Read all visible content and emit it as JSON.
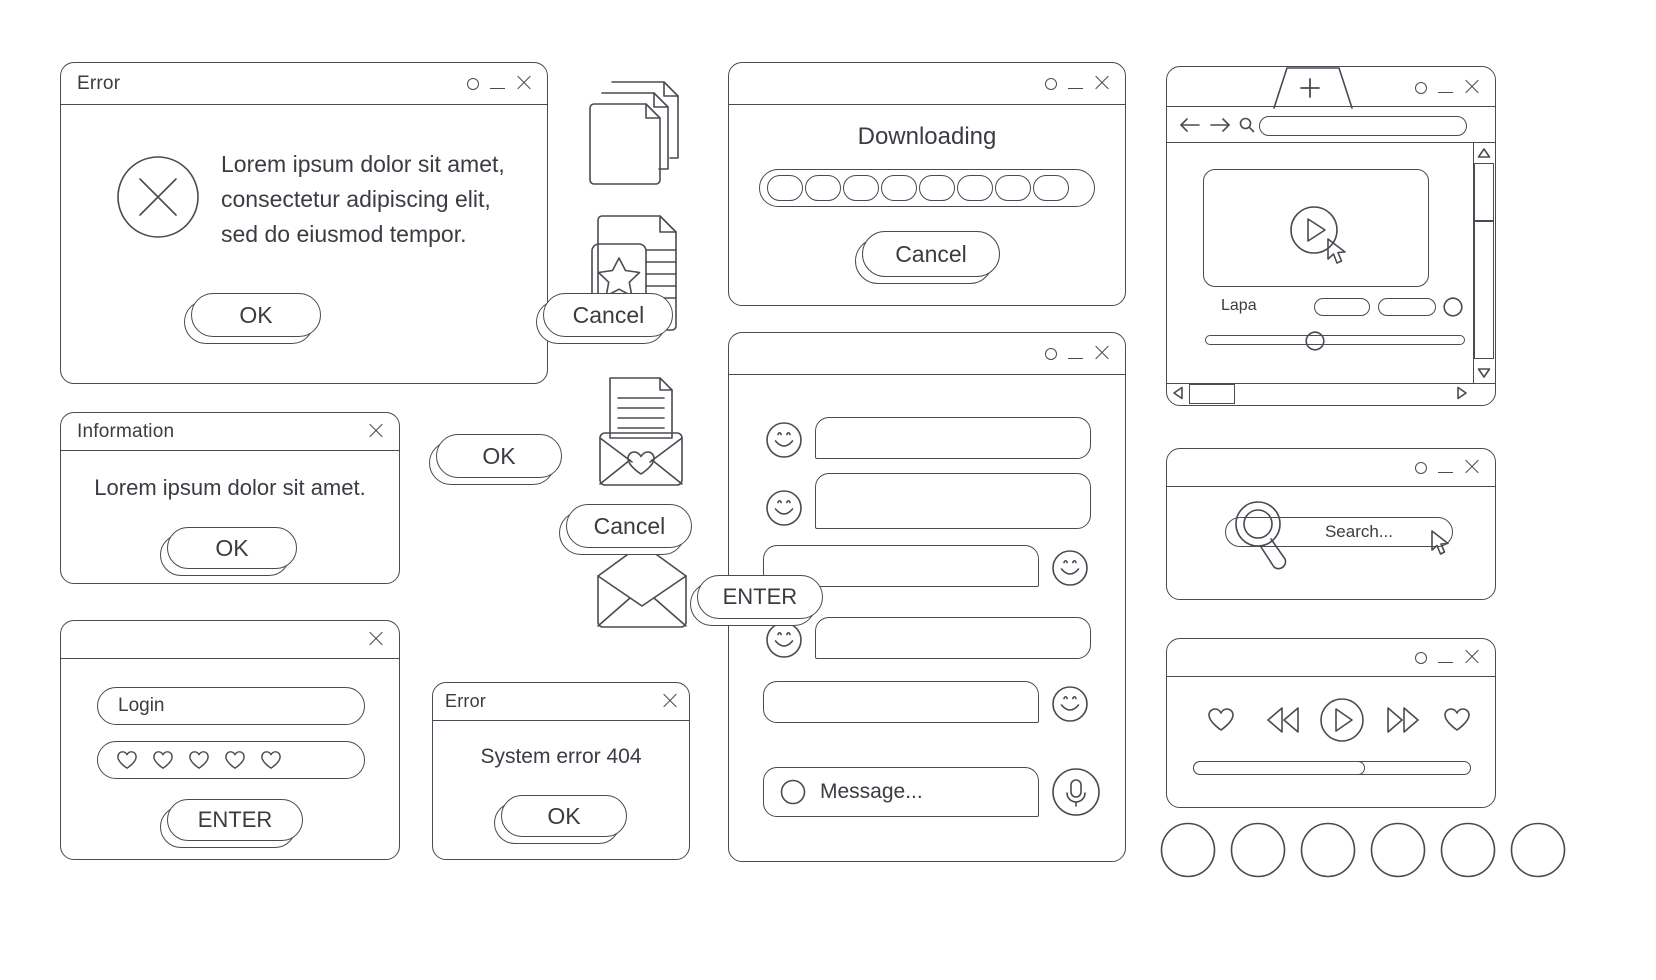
{
  "palette": {
    "stroke": "#4a4a52",
    "text": "#3b3b42",
    "background": "#ffffff"
  },
  "error_dialog": {
    "title": "Error",
    "icon": "error-circle-x-icon",
    "message_lines": [
      "Lorem ipsum dolor sit amet,",
      "consectetur adipiscing elit,",
      "sed do eiusmod tempor."
    ],
    "ok_label": "OK",
    "cancel_label": "Cancel",
    "controls": [
      "minimize-circle-icon",
      "minimize-icon",
      "close-icon"
    ]
  },
  "information_dialog": {
    "title": "Information",
    "message": "Lorem ipsum dolor sit amet.",
    "ok_label": "OK",
    "controls": [
      "close-icon"
    ]
  },
  "login_dialog": {
    "title": "",
    "username_value": "Login",
    "password_dots": 5,
    "password_icon": "heart-icon",
    "enter_label": "ENTER",
    "controls": [
      "close-icon"
    ]
  },
  "error404_dialog": {
    "title": "Error",
    "message": "System error 404",
    "ok_label": "OK",
    "controls": [
      "close-icon"
    ]
  },
  "standalone_buttons": [
    {
      "label": "OK"
    },
    {
      "label": "Cancel"
    },
    {
      "label": "ENTER"
    }
  ],
  "file_icons": [
    {
      "name": "documents-stack-icon"
    },
    {
      "name": "favorite-document-star-icon"
    },
    {
      "name": "mail-letter-heart-icon"
    },
    {
      "name": "open-envelope-icon"
    }
  ],
  "downloading_dialog": {
    "title": "",
    "heading": "Downloading",
    "progress_segments": 8,
    "cancel_label": "Cancel",
    "controls": [
      "minimize-circle-icon",
      "minimize-icon",
      "close-icon"
    ]
  },
  "chat_window": {
    "title": "",
    "controls": [
      "minimize-circle-icon",
      "minimize-icon",
      "close-icon"
    ],
    "messages": [
      {
        "side": "left",
        "avatar": "smiley-icon",
        "text": ""
      },
      {
        "side": "left",
        "avatar": "smiley-icon",
        "text": ""
      },
      {
        "side": "right",
        "avatar": "smiley-icon",
        "text": ""
      },
      {
        "side": "left",
        "avatar": "smiley-icon",
        "text": ""
      },
      {
        "side": "right",
        "avatar": "smiley-icon",
        "text": ""
      }
    ],
    "composer": {
      "attach_icon": "circle-icon",
      "placeholder": "Message...",
      "mic_icon": "microphone-icon"
    }
  },
  "browser_window": {
    "title": "",
    "controls": [
      "minimize-circle-icon",
      "minimize-icon",
      "close-icon"
    ],
    "new_tab_icon": "plus-icon",
    "nav": {
      "back_icon": "arrow-left-icon",
      "forward_icon": "arrow-right-icon",
      "search_icon": "search-icon",
      "address_value": ""
    },
    "video": {
      "play_icon": "play-circle-icon",
      "cursor_icon": "cursor-arrow-icon",
      "label": "Lapa",
      "pill_buttons": 2,
      "round_button_icon": "circle-icon",
      "slider_position_percent": 42
    },
    "scrollbars": {
      "vertical": {
        "up_icon": "triangle-up-icon",
        "down_icon": "triangle-down-icon"
      },
      "horizontal": {
        "left_icon": "triangle-left-icon",
        "right_icon": "triangle-right-icon"
      }
    }
  },
  "search_window": {
    "title": "",
    "controls": [
      "minimize-circle-icon",
      "minimize-icon",
      "close-icon"
    ],
    "search_icon": "magnifier-icon",
    "placeholder": "Search...",
    "cursor_icon": "cursor-arrow-icon"
  },
  "player_window": {
    "title": "",
    "controls": [
      "minimize-circle-icon",
      "minimize-icon",
      "close-icon"
    ],
    "buttons": [
      {
        "name": "heart-left-icon"
      },
      {
        "name": "rewind-icon"
      },
      {
        "name": "play-circle-icon"
      },
      {
        "name": "fast-forward-icon"
      },
      {
        "name": "heart-right-icon"
      }
    ],
    "progress_percent": 62
  },
  "circle_row": {
    "count": 6,
    "icon": "circle-icon"
  }
}
